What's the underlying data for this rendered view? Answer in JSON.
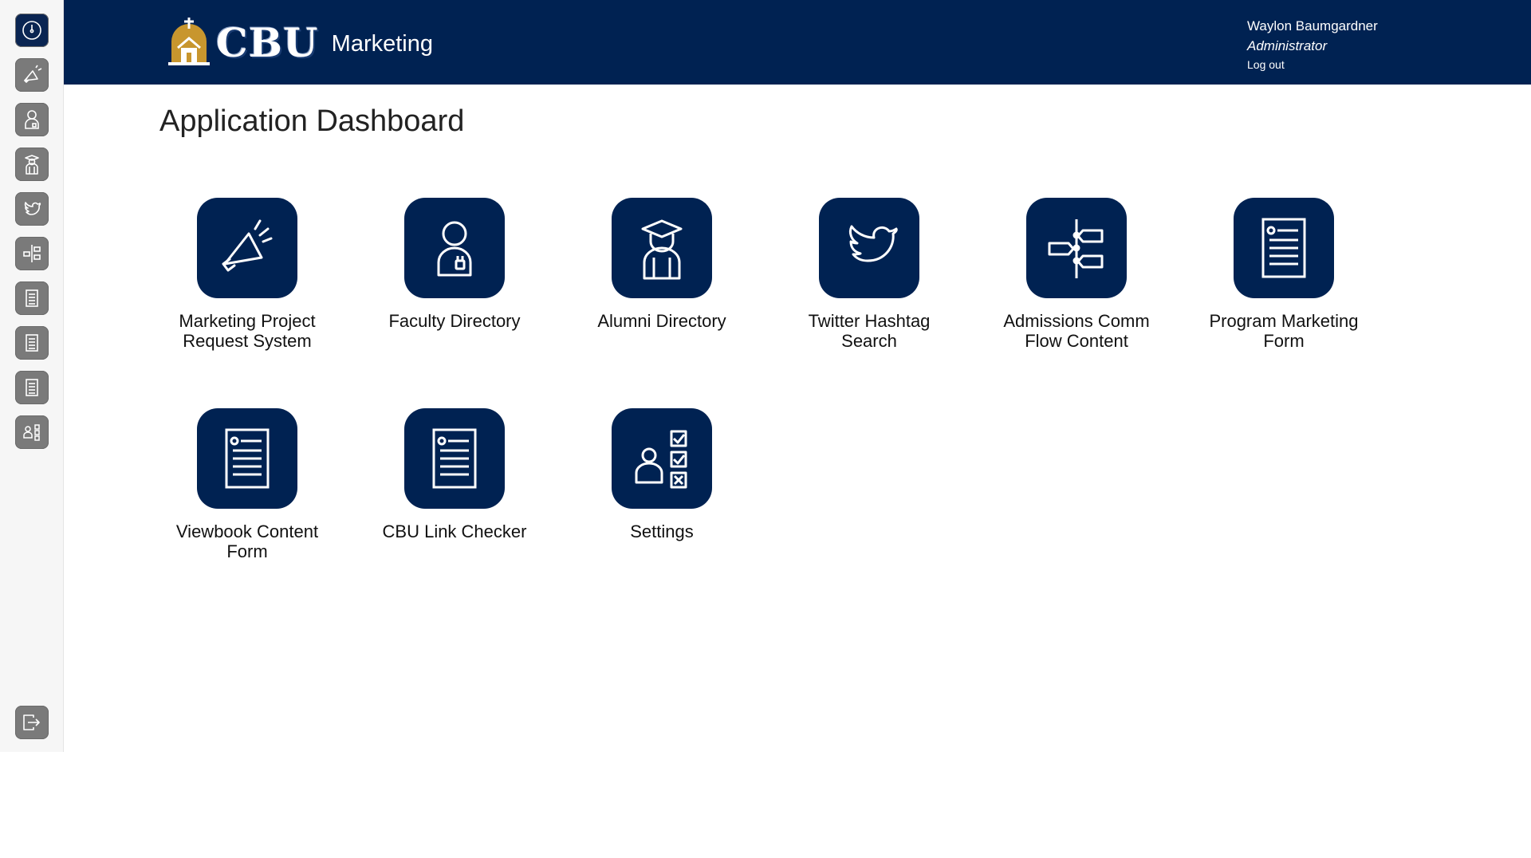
{
  "header": {
    "logo_text": "CBU",
    "app_name": "Marketing",
    "user_name": "Waylon Baumgardner",
    "user_role": "Administrator",
    "logout_label": "Log out"
  },
  "page": {
    "title": "Application Dashboard"
  },
  "apps": [
    {
      "label": "Marketing Project Request System",
      "icon": "megaphone-icon"
    },
    {
      "label": "Faculty Directory",
      "icon": "faculty-icon"
    },
    {
      "label": "Alumni Directory",
      "icon": "graduate-icon"
    },
    {
      "label": "Twitter Hashtag Search",
      "icon": "twitter-icon"
    },
    {
      "label": "Admissions Comm Flow Content",
      "icon": "flow-icon"
    },
    {
      "label": "Program Marketing Form",
      "icon": "form-icon"
    },
    {
      "label": "Viewbook Content Form",
      "icon": "form-icon"
    },
    {
      "label": "CBU Link Checker",
      "icon": "form-icon"
    },
    {
      "label": "Settings",
      "icon": "settings-icon"
    }
  ],
  "sidebar": {
    "items": [
      {
        "icon": "dashboard-icon"
      },
      {
        "icon": "megaphone-icon"
      },
      {
        "icon": "faculty-icon"
      },
      {
        "icon": "graduate-icon"
      },
      {
        "icon": "twitter-icon"
      },
      {
        "icon": "flow-icon"
      },
      {
        "icon": "form-icon"
      },
      {
        "icon": "form-icon"
      },
      {
        "icon": "form-icon"
      },
      {
        "icon": "settings-icon"
      }
    ],
    "exit_icon": "exit-icon"
  },
  "colors": {
    "navy": "#002252",
    "sidebar_button": "#7a7a7a",
    "logo_gold": "#c8962e"
  }
}
